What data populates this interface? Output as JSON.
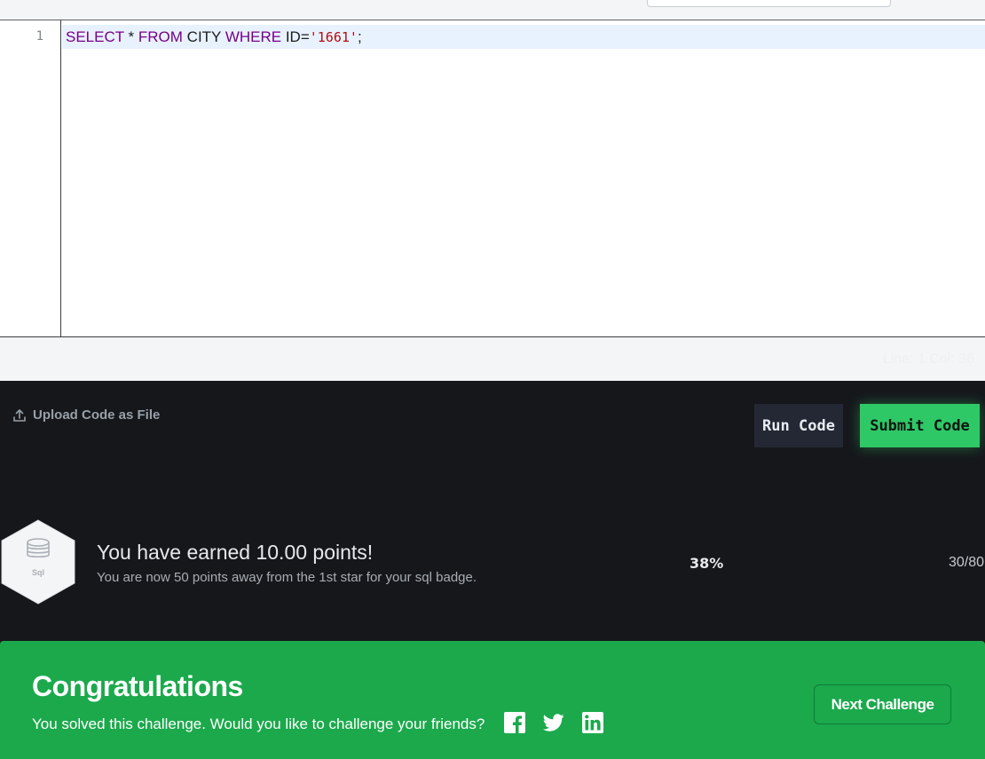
{
  "editor": {
    "line_number": "1",
    "code_tokens": {
      "kw_select": "SELECT",
      "star": " * ",
      "kw_from": "FROM",
      "table": " CITY ",
      "kw_where": "WHERE",
      "cond": " ID=",
      "value": "'1661'",
      "end": ";"
    }
  },
  "status": {
    "cursor_position": "Line: 1 Col: 36"
  },
  "actions": {
    "upload_label": "Upload Code as File",
    "run_label": "Run Code",
    "submit_label": "Submit Code"
  },
  "reward": {
    "badge_label": "Sql",
    "title": "You have earned 10.00 points!",
    "subtitle": "You are now 50 points away from the 1st star for your sql badge.",
    "progress_percent": "38%",
    "progress_score": "30/80",
    "progress_value": 0.38
  },
  "congrats": {
    "title": "Congratulations",
    "message": "You solved this challenge. Would you like to challenge your friends?",
    "next_label": "Next Challenge"
  },
  "colors": {
    "accent_green": "#2ec866",
    "panel_green": "#1ba94c",
    "dark_bg": "#16171b"
  },
  "icons": [
    "upload-icon",
    "database-icon",
    "facebook-icon",
    "twitter-icon",
    "linkedin-icon"
  ]
}
